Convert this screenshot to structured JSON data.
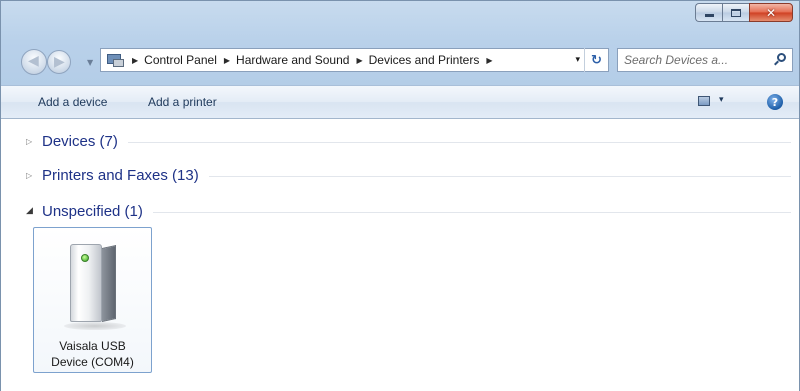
{
  "window": {
    "caption_buttons": {
      "minimize_icon": "minimize-icon",
      "maximize_icon": "maximize-icon",
      "close_glyph": "✕"
    }
  },
  "nav": {
    "back_icon": "back-arrow-icon",
    "forward_icon": "forward-arrow-icon"
  },
  "address": {
    "breadcrumbs": [
      "Control Panel",
      "Hardware and Sound",
      "Devices and Printers"
    ],
    "separator": "▶",
    "dropdown_glyph": "▾",
    "refresh_glyph": "↻"
  },
  "search": {
    "placeholder": "Search Devices a..."
  },
  "commands": {
    "add_device": "Add a device",
    "add_printer": "Add a printer",
    "view_dropdown_glyph": "▾",
    "help_glyph": "?"
  },
  "groups": [
    {
      "title": "Devices (7)",
      "expanded": false,
      "toggle_glyph": "▷"
    },
    {
      "title": "Printers and Faxes (13)",
      "expanded": false,
      "toggle_glyph": "▷"
    },
    {
      "title": "Unspecified (1)",
      "expanded": true,
      "toggle_glyph": "◢"
    }
  ],
  "device": {
    "label_line1": "Vaisala USB",
    "label_line2": "Device (COM4)",
    "icon": "usb-device-icon"
  },
  "colors": {
    "group_title": "#1e3287",
    "command_text": "#1e395b",
    "tile_border": "#7da2ce"
  }
}
